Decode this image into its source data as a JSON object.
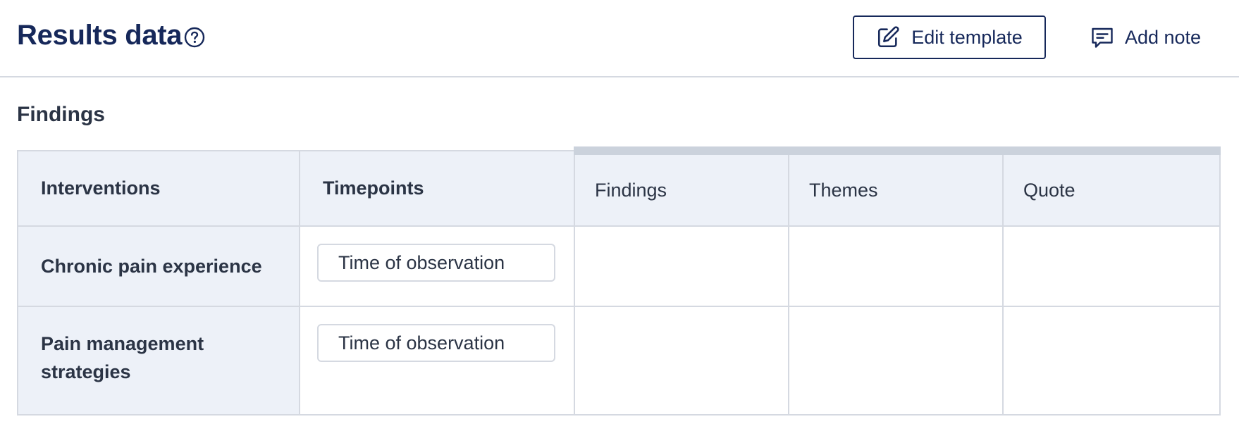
{
  "header": {
    "title": "Results data",
    "edit_label": "Edit template",
    "note_label": "Add note"
  },
  "section": {
    "title": "Findings"
  },
  "table": {
    "columns": [
      "Interventions",
      "Timepoints",
      "Findings",
      "Themes",
      "Quote"
    ],
    "rows": [
      {
        "intervention": "Chronic pain experience",
        "timepoint": "Time of observation"
      },
      {
        "intervention": "Pain management strategies",
        "timepoint": "Time of observation"
      }
    ]
  },
  "colors": {
    "brand": "#16285a",
    "text": "#2b3445",
    "header_bg": "#edf1f8",
    "border": "#d5d9e1"
  },
  "icons": [
    "help-icon",
    "edit-icon",
    "comment-icon"
  ]
}
